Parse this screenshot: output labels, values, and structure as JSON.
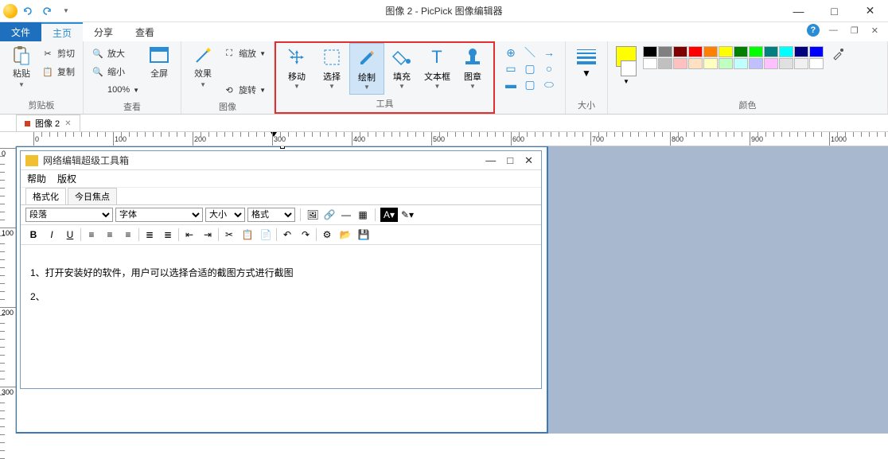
{
  "titlebar": {
    "title": "图像 2 - PicPick 图像编辑器"
  },
  "tabs": {
    "file": "文件",
    "home": "主页",
    "share": "分享",
    "view": "查看"
  },
  "ribbon": {
    "clipboard": {
      "label": "剪贴板",
      "paste": "粘贴",
      "cut": "剪切",
      "copy": "复制"
    },
    "view": {
      "label": "查看",
      "zoomin": "放大",
      "zoomout": "缩小",
      "zoom100": "100%",
      "fullscreen": "全屏"
    },
    "image": {
      "label": "图像",
      "effects": "效果",
      "resize": "缩放",
      "rotate": "旋转"
    },
    "tools": {
      "label": "工具",
      "move": "移动",
      "select": "选择",
      "draw": "绘制",
      "fill": "填充",
      "text": "文本框",
      "stamp": "图章"
    },
    "size": {
      "label": "大小"
    },
    "colors": {
      "label": "颜色",
      "current1": "#ffff00",
      "current2": "#ffffff",
      "grid": [
        "#000000",
        "#808080",
        "#800000",
        "#ff0000",
        "#ff8000",
        "#ffff00",
        "#008000",
        "#00ff00",
        "#008080",
        "#00ffff",
        "#000080",
        "#0000ff",
        "#ffffff",
        "#c0c0c0",
        "#ffc0c0",
        "#ffe0c0",
        "#ffffc0",
        "#c0ffc0",
        "#c0ffff",
        "#c0c0ff",
        "#ffc0ff",
        "#e0e0e0",
        "#f0f0f0",
        "#ffffff"
      ]
    }
  },
  "doc_tab": {
    "name": "图像 2"
  },
  "ruler": {
    "marks": [
      0,
      100,
      200,
      300,
      400,
      500,
      600,
      700,
      800,
      900,
      1000
    ],
    "vmarks": [
      0,
      100,
      200,
      300
    ]
  },
  "embed": {
    "title": "网络编辑超级工具箱",
    "menu": {
      "help": "帮助",
      "copyright": "版权"
    },
    "tabs": {
      "format": "格式化",
      "today": "今日焦点"
    },
    "toolbar": {
      "paragraph": "段落",
      "font": "字体",
      "sizeL": "大小",
      "formatL": "格式"
    },
    "content": {
      "line1": "1、打开安装好的软件，用户可以选择合适的截图方式进行截图",
      "line2": "2、"
    }
  }
}
